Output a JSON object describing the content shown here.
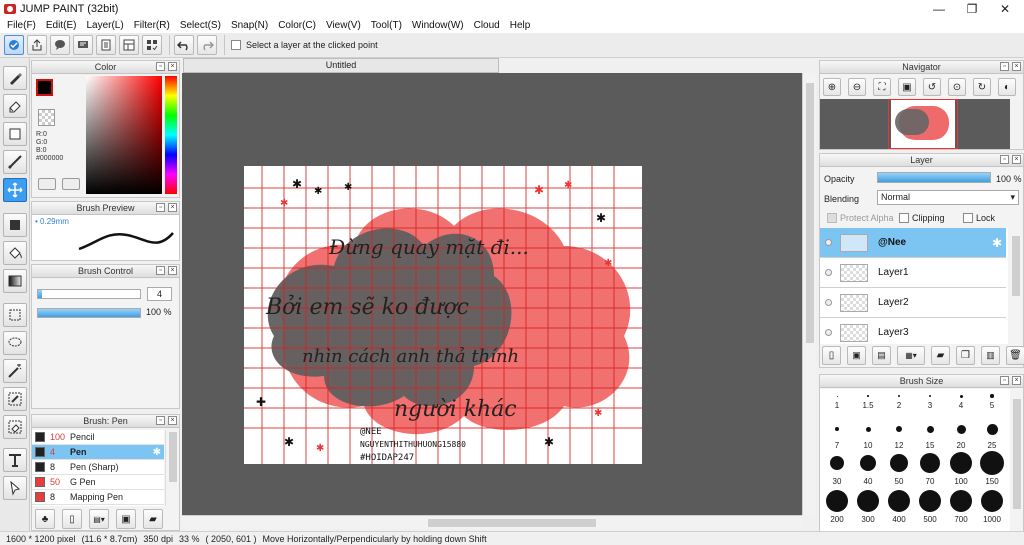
{
  "window": {
    "title": "JUMP PAINT (32bit)",
    "min": "—",
    "max": "❐",
    "close": "✕"
  },
  "menu": [
    "File(F)",
    "Edit(E)",
    "Layer(L)",
    "Filter(R)",
    "Select(S)",
    "Snap(N)",
    "Color(C)",
    "View(V)",
    "Tool(T)",
    "Window(W)",
    "Cloud",
    "Help"
  ],
  "toolbar": {
    "checkbox_label": "Select a layer at the clicked point"
  },
  "document": {
    "tab": "Untitled"
  },
  "color_panel": {
    "title": "Color",
    "r": "R:0",
    "g": "G:0",
    "b": "B:0",
    "hex": "#000000",
    "primary": "#000000",
    "secondary": "#ffffff"
  },
  "brush_preview": {
    "title": "Brush Preview",
    "size": "0.29mm"
  },
  "brush_control": {
    "title": "Brush Control",
    "size_value": "4",
    "opacity_value": "100 %"
  },
  "brush_list": {
    "title": "Brush: Pen",
    "items": [
      {
        "num": "100",
        "name": "Pencil",
        "color": "#222222",
        "num_color": "#d43a3a"
      },
      {
        "num": "4",
        "name": "Pen",
        "color": "#222222",
        "num_color": "#d43a3a"
      },
      {
        "num": "8",
        "name": "Pen (Sharp)",
        "color": "#222222",
        "num_color": "#111111"
      },
      {
        "num": "50",
        "name": "G Pen",
        "color": "#e83d3d",
        "num_color": "#d43a3a"
      },
      {
        "num": "8",
        "name": "Mapping Pen",
        "color": "#e83d3d",
        "num_color": "#111111"
      }
    ]
  },
  "navigator": {
    "title": "Navigator"
  },
  "layer_panel": {
    "title": "Layer",
    "opacity_label": "Opacity",
    "opacity_value": "100 %",
    "blending_label": "Blending",
    "blending_value": "Normal",
    "protect_alpha": "Protect Alpha",
    "clipping": "Clipping",
    "lock": "Lock",
    "layers": [
      {
        "name": "@Nee"
      },
      {
        "name": "Layer1"
      },
      {
        "name": "Layer2"
      },
      {
        "name": "Layer3"
      }
    ]
  },
  "brush_size": {
    "title": "Brush Size",
    "sizes": [
      "1",
      "1.5",
      "2",
      "3",
      "4",
      "5",
      "7",
      "10",
      "12",
      "15",
      "20",
      "25",
      "30",
      "40",
      "50",
      "70",
      "100",
      "150",
      "200",
      "300",
      "400",
      "500",
      "700",
      "1000"
    ]
  },
  "artwork": {
    "line1": "Đừng quay mặt đi...",
    "line2": "Bởi em sẽ ko được",
    "line3": "nhìn cách anh thả thính",
    "line4": "người khác",
    "sig1": "@NEE",
    "sig2": "NGUYENTHITHUHUONG15880",
    "sig3": "#HOIDAP247"
  },
  "status": {
    "size": "1600 * 1200 pixel",
    "cm": "(11.6 * 8.7cm)",
    "dpi": "350 dpi",
    "zoom": "33 %",
    "coords": "( 2050, 601 )",
    "hint": "Move Horizontally/Perpendicularly by holding down Shift"
  }
}
